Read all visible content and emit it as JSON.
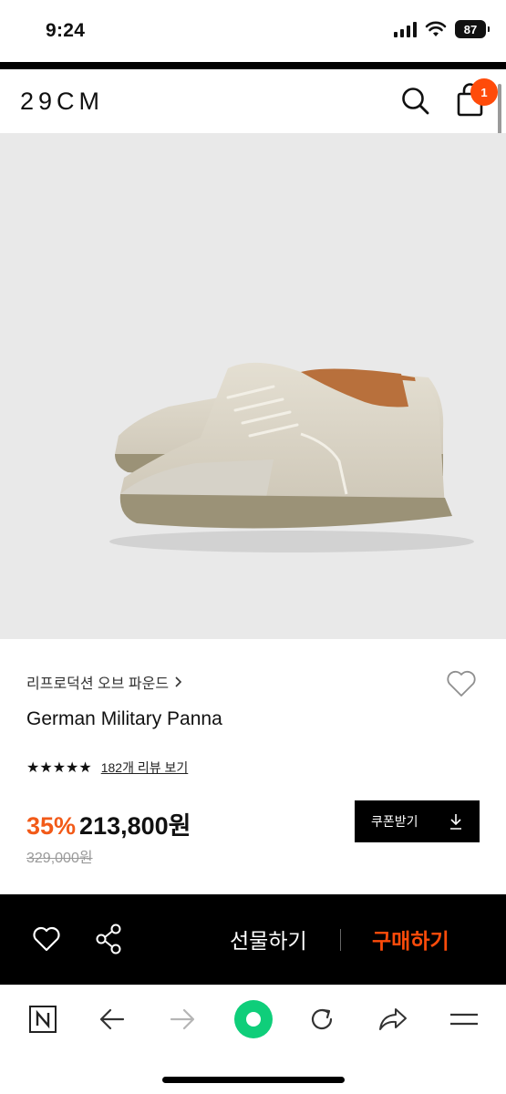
{
  "status_bar": {
    "time": "9:24",
    "battery": "87"
  },
  "header": {
    "logo": "29CM",
    "cart_count": "1"
  },
  "product": {
    "brand": "리프로덕션 오브 파운드",
    "name": "German Military Panna",
    "stars": "★★★★★",
    "review_link": "182개 리뷰 보기",
    "discount": "35%",
    "sale_price": "213,800원",
    "original_price": "329,000원",
    "coupon_label": "쿠폰받기"
  },
  "action_bar": {
    "gift_label": "선물하기",
    "buy_label": "구매하기"
  },
  "colors": {
    "accent": "#ff4b0a",
    "discount": "#f25a18",
    "image_bg": "#e9e9e9"
  }
}
